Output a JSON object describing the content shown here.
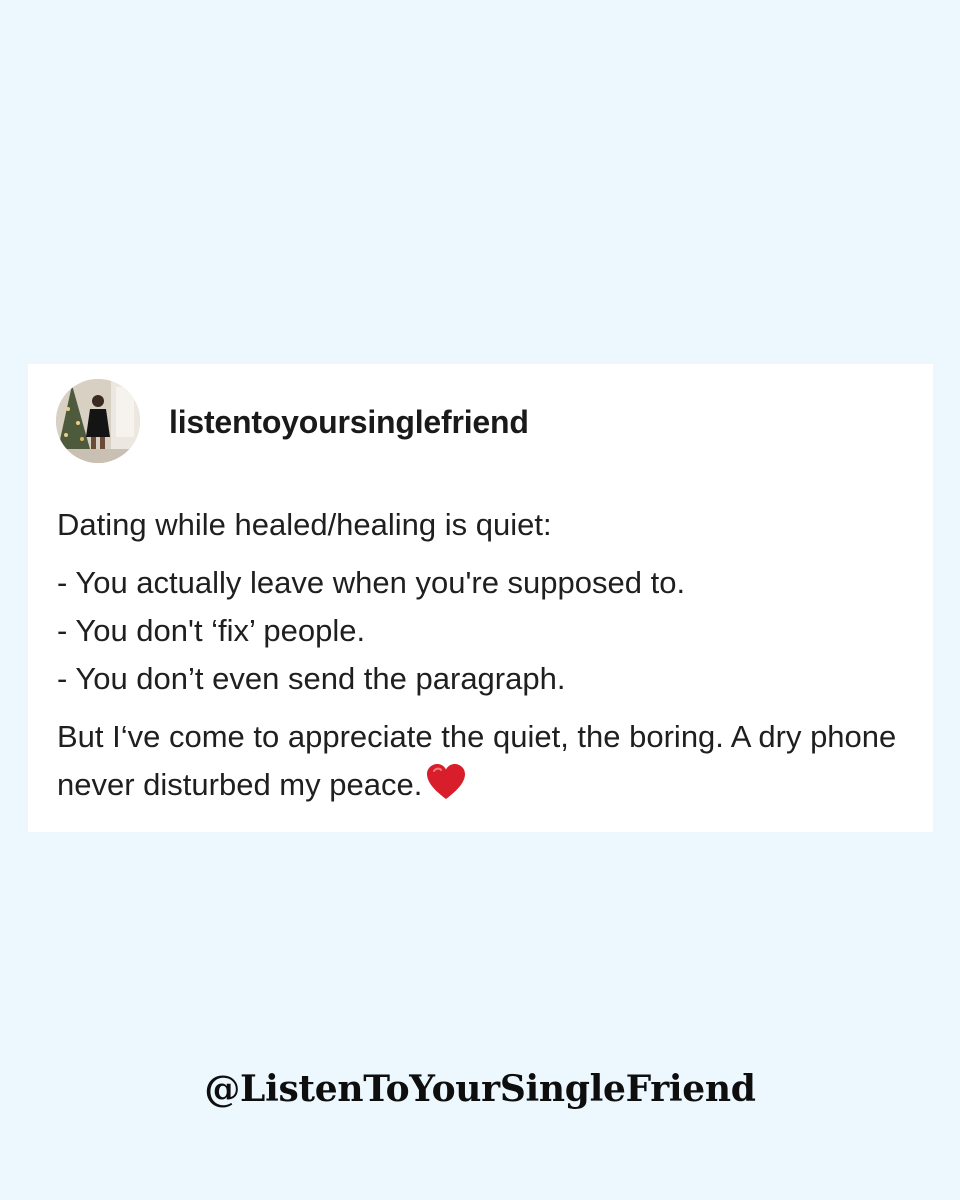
{
  "post": {
    "username": "listentoyoursinglefriend",
    "avatar_icon": "profile-photo",
    "intro": "Dating while healed/healing is quiet:",
    "bullets": [
      "- You actually leave when you're supposed to.",
      "- You don't ‘fix’ people.",
      "- You don’t even send the paragraph."
    ],
    "closing": "But I‘ve come to appreciate the quiet, the boring. A dry phone never disturbed my peace.",
    "closing_emoji": "heart-icon",
    "heart_color": "#d81e2a"
  },
  "footer": {
    "handle": "@ListenToYourSingleFriend"
  },
  "colors": {
    "background": "#ecf8fe",
    "card": "#ffffff",
    "text": "#1f1f1f"
  }
}
